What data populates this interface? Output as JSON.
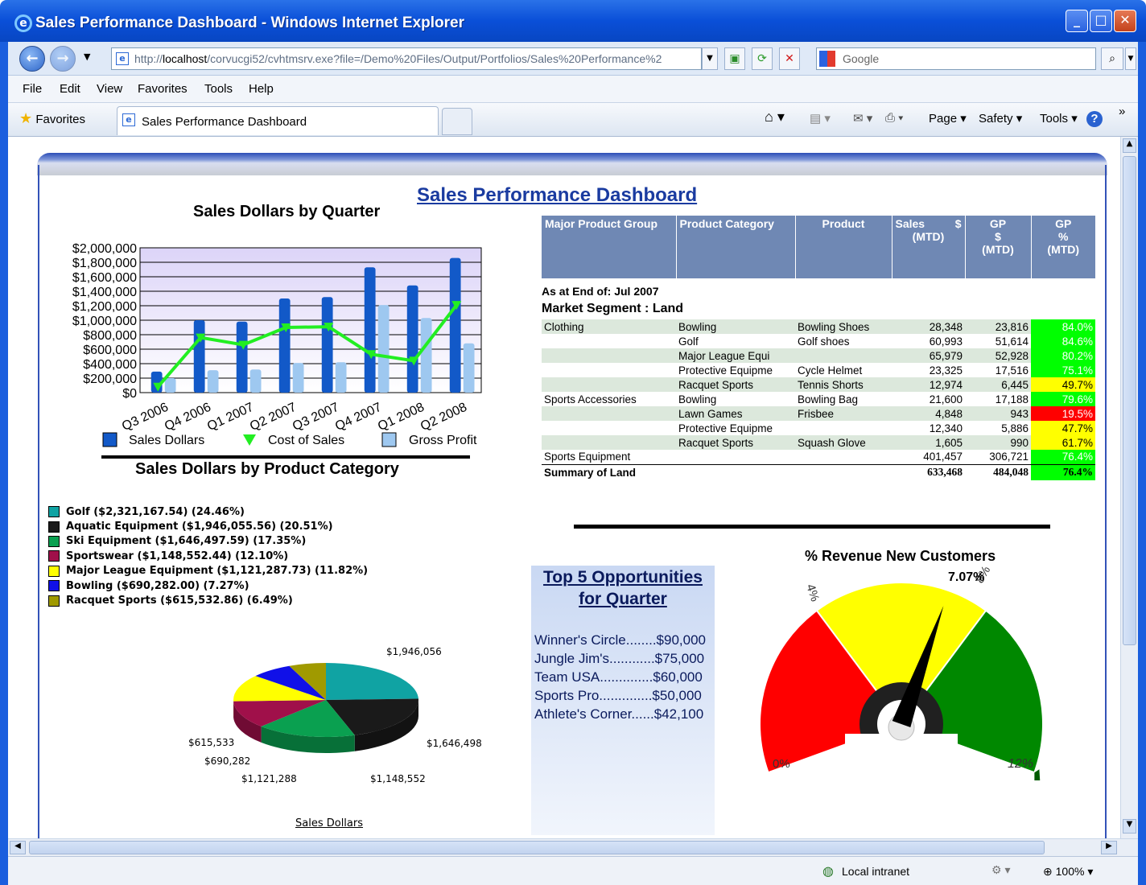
{
  "window": {
    "title": "Sales Performance Dashboard - Windows Internet Explorer",
    "url_prefix": "http://",
    "url_host": "localhost",
    "url_rest": "/corvucgi52/cvhtmsrv.exe?file=/Demo%20Files/Output/Portfolios/Sales%20Performance%2",
    "search_placeholder": "Google",
    "favorites_label": "Favorites",
    "tab_label": "Sales Performance Dashboard"
  },
  "menu": [
    "File",
    "Edit",
    "View",
    "Favorites",
    "Tools",
    "Help"
  ],
  "commandbar": {
    "page": "Page",
    "safety": "Safety",
    "tools": "Tools"
  },
  "status": {
    "zone": "Local intranet",
    "zoom": "100%"
  },
  "dashboard": {
    "title": "Sales Performance Dashboard",
    "chart1_title": "Sales Dollars by Quarter",
    "chart2_title": "Sales Dollars by Product Category",
    "pie_caption": "Sales Dollars",
    "gauge_title": "% Revenue New Customers",
    "opp_title_1": "Top 5 Opportunities",
    "opp_title_2": "for Quarter",
    "opportunities": [
      "Winner's Circle........$90,000",
      "Jungle Jim's............$75,000",
      "Team USA..............$60,000",
      "Sports Pro..............$50,000",
      "Athlete's Corner......$42,100"
    ]
  },
  "table": {
    "headers": {
      "major": "Major Product Group",
      "category": "Product Category",
      "product": "Product",
      "sales_1": "Sales",
      "sales_2": "$",
      "sales_3": "(MTD)",
      "gp_1": "GP",
      "gp_2": "$",
      "gp_3": "(MTD)",
      "gpp_1": "GP",
      "gpp_2": "%",
      "gpp_3": "(MTD)"
    },
    "as_at": "As at End of: Jul 2007",
    "segment": "Market Segment : Land",
    "rows": [
      {
        "major": "Clothing",
        "category": "Bowling",
        "product": "Bowling Shoes",
        "sales": "28,348",
        "gp": "23,816",
        "gpp": "84.0%",
        "color": "#00ff00",
        "tc": "#ffffff"
      },
      {
        "major": "",
        "category": "Golf",
        "product": "Golf shoes",
        "sales": "60,993",
        "gp": "51,614",
        "gpp": "84.6%",
        "color": "#00ff00",
        "tc": "#ffffff"
      },
      {
        "major": "",
        "category": "Major League Equi",
        "product": "",
        "sales": "65,979",
        "gp": "52,928",
        "gpp": "80.2%",
        "color": "#00ff00",
        "tc": "#ffffff"
      },
      {
        "major": "",
        "category": "Protective Equipme",
        "product": "Cycle Helmet",
        "sales": "23,325",
        "gp": "17,516",
        "gpp": "75.1%",
        "color": "#00ff00",
        "tc": "#ffffff"
      },
      {
        "major": "",
        "category": "Racquet Sports",
        "product": "Tennis Shorts",
        "sales": "12,974",
        "gp": "6,445",
        "gpp": "49.7%",
        "color": "#ffff00",
        "tc": "#000000"
      },
      {
        "major": "Sports Accessories",
        "category": "Bowling",
        "product": "Bowling Bag",
        "sales": "21,600",
        "gp": "17,188",
        "gpp": "79.6%",
        "color": "#00ff00",
        "tc": "#ffffff"
      },
      {
        "major": "",
        "category": "Lawn Games",
        "product": "Frisbee",
        "sales": "4,848",
        "gp": "943",
        "gpp": "19.5%",
        "color": "#ff0000",
        "tc": "#ffffff"
      },
      {
        "major": "",
        "category": "Protective Equipme",
        "product": "",
        "sales": "12,340",
        "gp": "5,886",
        "gpp": "47.7%",
        "color": "#ffff00",
        "tc": "#000000"
      },
      {
        "major": "",
        "category": "Racquet Sports",
        "product": "Squash Glove",
        "sales": "1,605",
        "gp": "990",
        "gpp": "61.7%",
        "color": "#ffff00",
        "tc": "#000000"
      },
      {
        "major": "Sports Equipment",
        "category": "",
        "product": "",
        "sales": "401,457",
        "gp": "306,721",
        "gpp": "76.4%",
        "color": "#00ff00",
        "tc": "#ffffff"
      }
    ],
    "summary": {
      "label": "Summary of Land",
      "sales": "633,468",
      "gp": "484,048",
      "gpp": "76.4%"
    }
  },
  "chart_data": [
    {
      "type": "bar",
      "title": "Sales Dollars by Quarter",
      "categories": [
        "Q3 2006",
        "Q4 2006",
        "Q1 2007",
        "Q2 2007",
        "Q3 2007",
        "Q4 2007",
        "Q1 2008",
        "Q2 2008"
      ],
      "ylim": [
        0,
        2000000
      ],
      "yticks": [
        "$2,000,000",
        "$1,800,000",
        "$1,600,000",
        "$1,400,000",
        "$1,200,000",
        "$1,000,000",
        "$800,000",
        "$600,000",
        "$400,000",
        "$200,000",
        "$0"
      ],
      "series": [
        {
          "name": "Sales Dollars",
          "kind": "bar",
          "color": "#1259c8",
          "values": [
            290000,
            1000000,
            980000,
            1300000,
            1320000,
            1730000,
            1480000,
            1860000
          ]
        },
        {
          "name": "Cost of Sales",
          "kind": "line",
          "color": "#22ee22",
          "values": [
            80000,
            760000,
            660000,
            900000,
            910000,
            530000,
            440000,
            1210000
          ]
        },
        {
          "name": "Gross Profit",
          "kind": "bar",
          "color": "#9ec8f0",
          "values": [
            200000,
            310000,
            320000,
            410000,
            420000,
            1210000,
            1030000,
            680000
          ]
        }
      ]
    },
    {
      "type": "pie",
      "title": "Sales Dollars by Product Category",
      "legend": [
        "Golf ($2,321,167.54) (24.46%)",
        "Aquatic Equipment ($1,946,055.56) (20.51%)",
        "Ski Equipment ($1,646,497.59) (17.35%)",
        "Sportswear ($1,148,552.44) (12.10%)",
        "Major League Equipment ($1,121,287.73) (11.82%)",
        "Bowling ($690,282.00) (7.27%)",
        "Racquet Sports ($615,532.86) (6.49%)"
      ],
      "slices": [
        {
          "name": "Golf",
          "value": 2321167.54,
          "label": "$2,321,168",
          "color": "#10a3a3"
        },
        {
          "name": "Aquatic Equipment",
          "value": 1946055.56,
          "label": "$1,946,056",
          "color": "#1a1a1a"
        },
        {
          "name": "Ski Equipment",
          "value": 1646497.59,
          "label": "$1,646,498",
          "color": "#0aa050"
        },
        {
          "name": "Sportswear",
          "value": 1148552.44,
          "label": "$1,148,552",
          "color": "#a0104a"
        },
        {
          "name": "Major League Equipment",
          "value": 1121287.73,
          "label": "$1,121,288",
          "color": "#ffff00"
        },
        {
          "name": "Bowling",
          "value": 690282.0,
          "label": "$690,282",
          "color": "#1010e8"
        },
        {
          "name": "Racquet Sports",
          "value": 615532.86,
          "label": "$615,533",
          "color": "#a09a00"
        }
      ]
    },
    {
      "type": "gauge",
      "title": "% Revenue New Customers",
      "min": 0,
      "max": 12,
      "value": 7.07,
      "value_label": "7.07%",
      "tick_labels": [
        "0%",
        "4%",
        "8%",
        "12%"
      ],
      "bands": [
        {
          "from": 0,
          "to": 4,
          "color": "#ff0000"
        },
        {
          "from": 4,
          "to": 8,
          "color": "#ffff00"
        },
        {
          "from": 8,
          "to": 12,
          "color": "#008800"
        }
      ]
    }
  ]
}
